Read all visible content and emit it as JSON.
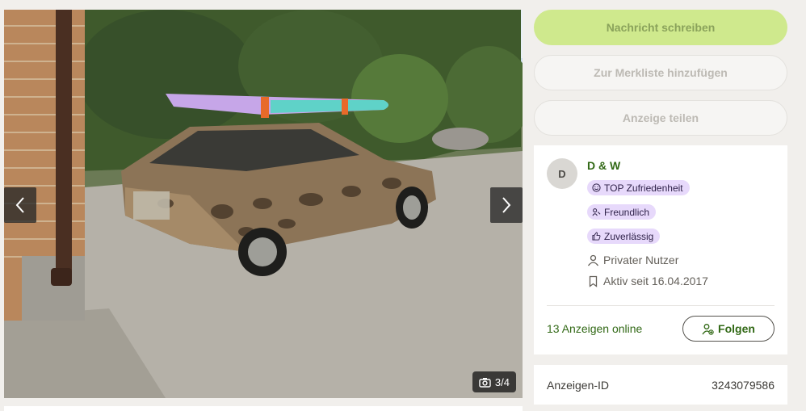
{
  "gallery": {
    "counter_text": "3/4",
    "current_image": 3,
    "total_images": 4
  },
  "actions": {
    "message_label": "Nachricht schreiben",
    "watchlist_label": "Zur Merkliste hinzufügen",
    "share_label": "Anzeige teilen"
  },
  "seller": {
    "avatar_initial": "D",
    "name": "D & W",
    "badges": [
      {
        "label": "TOP Zufriedenheit",
        "icon": "smile-icon"
      },
      {
        "label": "Freundlich",
        "icon": "handshake-icon"
      },
      {
        "label": "Zuverlässig",
        "icon": "thumbs-up-icon"
      }
    ],
    "type": "Privater Nutzer",
    "active_since": "Aktiv seit 16.04.2017",
    "ads_online": "13 Anzeigen online",
    "follow_label": "Folgen"
  },
  "ad": {
    "id_label": "Anzeigen-ID",
    "id_value": "3243079586"
  },
  "colors": {
    "primary_button": "#cfe98d",
    "brand_green": "#326916",
    "badge_bg": "#e7d9fb"
  }
}
